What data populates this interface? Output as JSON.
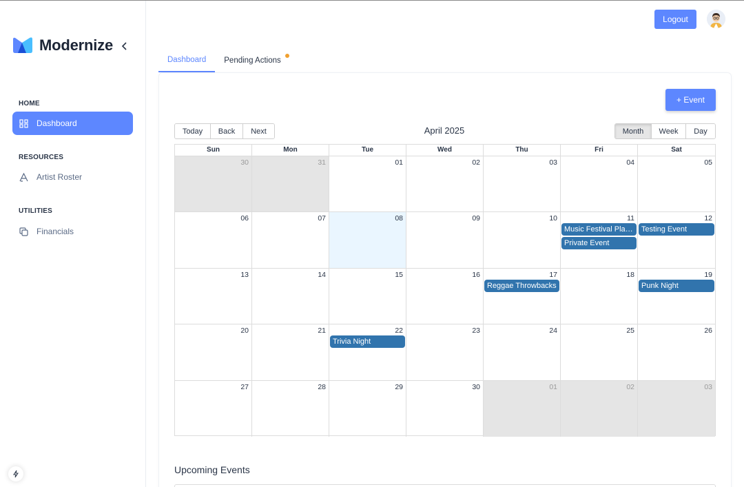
{
  "brand": {
    "name": "Modernize",
    "colors": {
      "logo_a": "#5d87ff",
      "logo_b": "#49beff"
    }
  },
  "sidebar": {
    "sections": [
      {
        "caption": "HOME",
        "items": [
          {
            "label": "Dashboard",
            "icon": "layout-dashboard-icon",
            "active": true
          }
        ]
      },
      {
        "caption": "RESOURCES",
        "items": [
          {
            "label": "Artist Roster",
            "icon": "typography-icon",
            "active": false
          }
        ]
      },
      {
        "caption": "UTILITIES",
        "items": [
          {
            "label": "Financials",
            "icon": "copy-icon",
            "active": false
          }
        ]
      }
    ]
  },
  "header": {
    "logout_label": "Logout",
    "avatar": "user-avatar"
  },
  "tabs": [
    {
      "label": "Dashboard",
      "active": true
    },
    {
      "label": "Pending Actions",
      "active": false,
      "has_notification_dot": true
    }
  ],
  "toolbar": {
    "add_event_label": "+ Event",
    "nav_buttons": [
      "Today",
      "Back",
      "Next"
    ],
    "label": "April 2025",
    "view_buttons": [
      "Month",
      "Week",
      "Day"
    ],
    "active_view": "Month"
  },
  "calendar": {
    "weekdays": [
      "Sun",
      "Mon",
      "Tue",
      "Wed",
      "Thu",
      "Fri",
      "Sat"
    ],
    "weeks": [
      [
        {
          "n": "30",
          "off": true
        },
        {
          "n": "31",
          "off": true
        },
        {
          "n": "01"
        },
        {
          "n": "02"
        },
        {
          "n": "03"
        },
        {
          "n": "04"
        },
        {
          "n": "05"
        }
      ],
      [
        {
          "n": "06"
        },
        {
          "n": "07"
        },
        {
          "n": "08",
          "today": true
        },
        {
          "n": "09"
        },
        {
          "n": "10"
        },
        {
          "n": "11",
          "events": [
            "Music Festival Planning",
            "Private Event"
          ]
        },
        {
          "n": "12",
          "events": [
            "Testing Event"
          ]
        }
      ],
      [
        {
          "n": "13"
        },
        {
          "n": "14"
        },
        {
          "n": "15"
        },
        {
          "n": "16"
        },
        {
          "n": "17",
          "events": [
            "Reggae Throwbacks"
          ]
        },
        {
          "n": "18"
        },
        {
          "n": "19",
          "events": [
            "Punk Night"
          ]
        }
      ],
      [
        {
          "n": "20"
        },
        {
          "n": "21"
        },
        {
          "n": "22",
          "events": [
            "Trivia Night"
          ]
        },
        {
          "n": "23"
        },
        {
          "n": "24"
        },
        {
          "n": "25"
        },
        {
          "n": "26"
        }
      ],
      [
        {
          "n": "27"
        },
        {
          "n": "28"
        },
        {
          "n": "29"
        },
        {
          "n": "30"
        },
        {
          "n": "01",
          "off": true
        },
        {
          "n": "02",
          "off": true
        },
        {
          "n": "03",
          "off": true
        }
      ]
    ],
    "event_color": "#3174ad",
    "today_color": "#eaf6ff"
  },
  "upcoming": {
    "title": "Upcoming Events"
  }
}
